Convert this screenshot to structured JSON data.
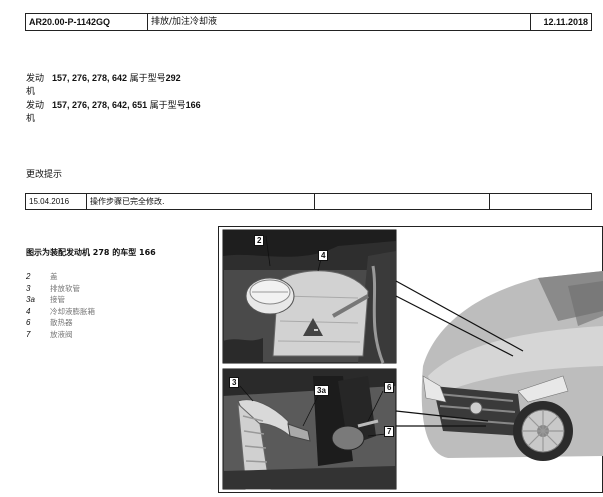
{
  "header": {
    "doc_number": "AR20.00-P-1142GQ",
    "title": "排放/加注冷却液",
    "date": "12.11.2018"
  },
  "engines": [
    {
      "label_line1": "发动",
      "label_line2": "机",
      "numbers": "157, 276, 278, 642",
      "suffix": "属于型号",
      "model": "292"
    },
    {
      "label_line1": "发动",
      "label_line2": "机",
      "numbers": "157, 276, 278, 642, 651",
      "suffix": "属于型号",
      "model": "166"
    }
  ],
  "change_notes": {
    "heading": "更改提示",
    "rows": [
      {
        "date": "15.04.2016",
        "note": "操作步骤已完全修改.",
        "extra1": "",
        "extra2": ""
      }
    ]
  },
  "figure": {
    "caption": "图示为装配发动机 278 的车型 166",
    "legend": [
      {
        "key": "2",
        "label": "盖"
      },
      {
        "key": "3",
        "label": "排放软管"
      },
      {
        "key": "3a",
        "label": "接管"
      },
      {
        "key": "4",
        "label": "冷却液膨胀箱"
      },
      {
        "key": "6",
        "label": "散热器"
      },
      {
        "key": "7",
        "label": "放液阀"
      }
    ],
    "callouts": {
      "c2": "2",
      "c4": "4",
      "c3": "3",
      "c3a": "3a",
      "c6": "6",
      "c7": "7"
    }
  }
}
